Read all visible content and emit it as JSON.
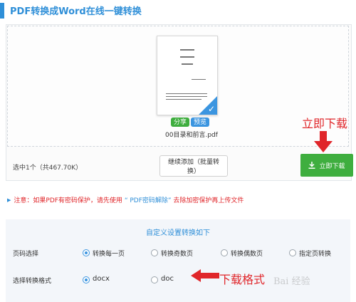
{
  "header": {
    "title": "PDF转换成Word在线一键转换"
  },
  "file": {
    "name": "00目录和前言.pdf",
    "share_label": "分享",
    "preview_label": "预览"
  },
  "upload": {
    "selected_info": "选中1个（共467.70K）",
    "continue_label": "继续添加（批量转换）",
    "download_label": "立即下载"
  },
  "annotations": {
    "download": "立即下载",
    "format": "下载格式"
  },
  "notice": {
    "prefix": "注意：如果PDF有密码保护，请先使用",
    "link": "“ PDF密码解除”",
    "suffix": "去除加密保护再上传文件"
  },
  "options": {
    "title": "自定义设置转换如下",
    "page_row": {
      "label": "页码选择",
      "choices": [
        "转换每一页",
        "转换奇数页",
        "转换偶数页",
        "指定页转换"
      ],
      "selected": 0
    },
    "format_row": {
      "label": "选择转换格式",
      "choices": [
        "docx",
        "doc"
      ],
      "selected": 0
    }
  },
  "watermark": "Bai 经验",
  "colors": {
    "accent": "#2f8fd8",
    "success": "#3fae3f",
    "alert": "#e0262a"
  }
}
